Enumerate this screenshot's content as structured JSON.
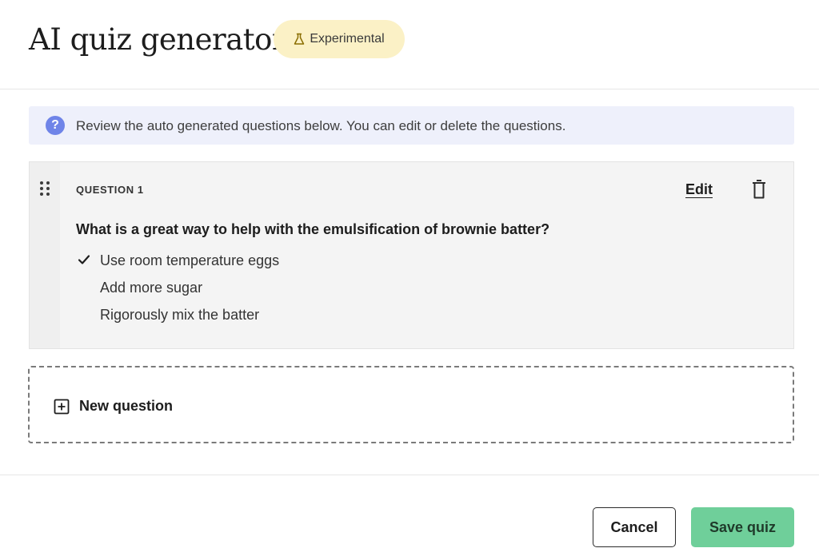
{
  "header": {
    "title": "AI quiz generator",
    "badge_label": "Experimental",
    "badge_icon": "flask-icon"
  },
  "banner": {
    "icon": "question-circle-icon",
    "icon_glyph": "?",
    "text": "Review the auto generated questions below. You can edit or delete the questions."
  },
  "question": {
    "label": "QUESTION 1",
    "edit_label": "Edit",
    "text": "What is a great way to help with the emulsification of brownie batter?",
    "answers": [
      {
        "text": "Use room temperature eggs",
        "correct": true
      },
      {
        "text": "Add more sugar",
        "correct": false
      },
      {
        "text": "Rigorously mix the batter",
        "correct": false
      }
    ]
  },
  "new_question": {
    "label": "New question",
    "icon": "plus-square-icon"
  },
  "footer": {
    "cancel_label": "Cancel",
    "save_label": "Save quiz"
  },
  "colors": {
    "badge_bg": "#fbf1c6",
    "banner_bg": "#eef0fb",
    "info_icon": "#6f84e8",
    "save_button": "#6fcf9a"
  }
}
